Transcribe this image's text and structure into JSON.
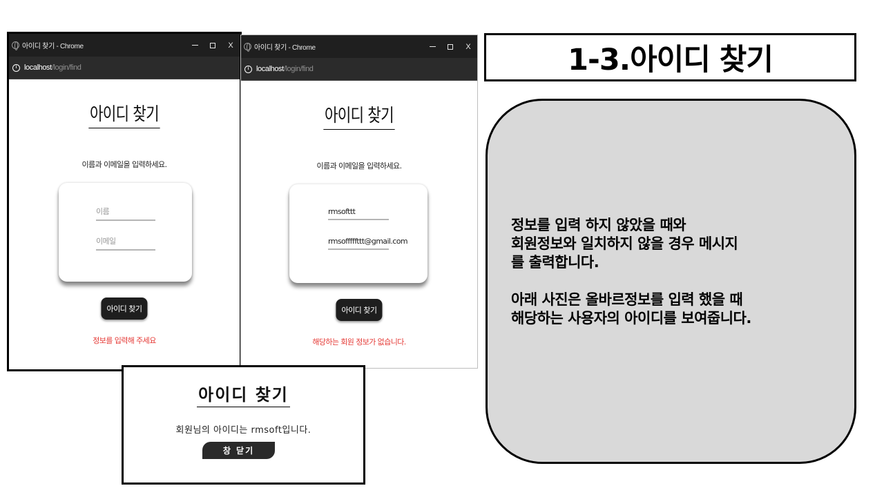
{
  "left_window": {
    "title": "아이디 찾기 - Chrome",
    "controls": {
      "minimize": "–",
      "maximize": "☐",
      "close": "X"
    },
    "url_host": "localhost",
    "url_path": "/login/find",
    "heading": "아이디 찾기",
    "instruction": "이름과 이메일을 입력하세요.",
    "name_placeholder": "이름",
    "email_placeholder": "이메일",
    "name_value": "",
    "email_value": "",
    "button": "아이디 찾기",
    "error": "정보를 입력해 주세요"
  },
  "right_window": {
    "title": "아이디 찾기 - Chrome",
    "controls": {
      "minimize": "–",
      "maximize": "☐",
      "close": "X"
    },
    "url_host": "localhost",
    "url_path": "/login/find",
    "heading": "아이디 찾기",
    "instruction": "이름과 이메일을 입력하세요.",
    "name_value": "rmsofttt",
    "email_value": "rmsofffffttt@gmail.com",
    "button": "아이디 찾기",
    "error": "해당하는 회원 정보가 없습니다."
  },
  "result_popup": {
    "heading": "아이디 찾기",
    "message": "회원님의 아이디는 rmsoft입니다.",
    "close_button": "창 닫기"
  },
  "slide": {
    "title": "1-3.아이디 찾기",
    "description_lines": [
      "정보를 입력 하지 않았을 때와",
      "회원정보와 일치하지 않을 경우 메시지",
      "를 출력합니다.",
      "아래 사진은 올바르정보를 입력 했을 때",
      "해당하는 사용자의 아이디를 보여줍니다."
    ]
  },
  "colors": {
    "error": "#e53935",
    "titlebar": "#1f1f1f",
    "addressbar": "#2b2b2b",
    "button": "#1e1e1e",
    "description_bg": "#d9d9d9"
  },
  "icons": [
    "globe-icon",
    "site-info-icon",
    "minimize-icon",
    "maximize-icon",
    "close-icon"
  ]
}
